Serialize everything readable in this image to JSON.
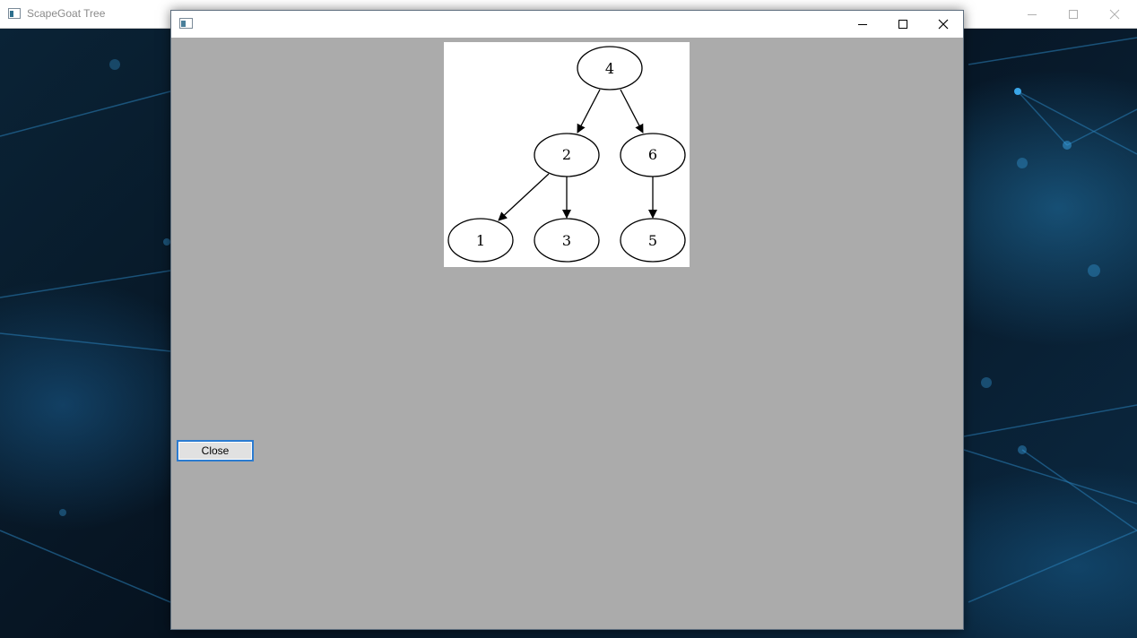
{
  "main_window": {
    "title": "ScapeGoat Tree",
    "app_icon": "app-window-icon",
    "controls": [
      "minimize-icon",
      "maximize-icon",
      "close-icon"
    ]
  },
  "dialog": {
    "app_icon": "app-window-icon",
    "controls": [
      "minimize-icon",
      "maximize-icon",
      "close-icon"
    ],
    "close_button_label": "Close"
  },
  "tree": {
    "nodes": [
      "4",
      "2",
      "6",
      "1",
      "3",
      "5"
    ],
    "edges": [
      [
        "4",
        "2"
      ],
      [
        "4",
        "6"
      ],
      [
        "2",
        "1"
      ],
      [
        "2",
        "3"
      ],
      [
        "6",
        "5"
      ]
    ]
  },
  "colors": {
    "dialog_background": "#ababab",
    "button_focus_border": "#2b7bd0"
  }
}
